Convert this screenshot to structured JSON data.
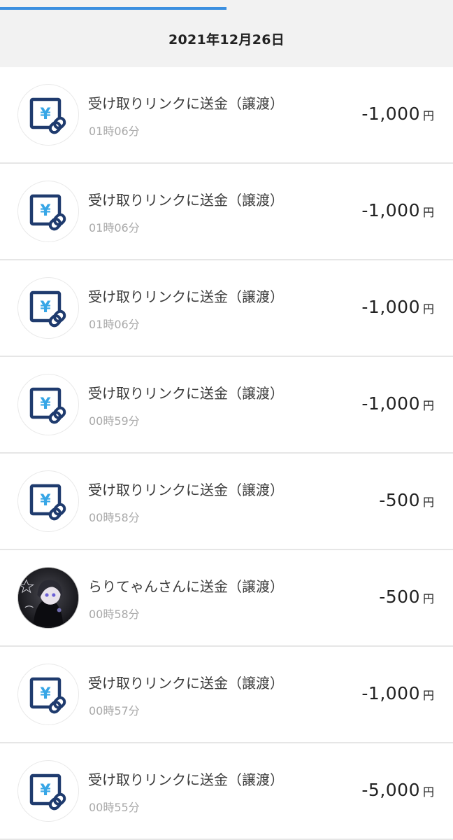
{
  "header": {
    "date": "2021年12月26日"
  },
  "colors": {
    "accent": "#3b8fe0",
    "icon_navy": "#1f3b6e",
    "icon_light_blue": "#37a6e6"
  },
  "transactions": [
    {
      "title": "受け取りリンクに送金（譲渡）",
      "time": "01時06分",
      "amount": "-1,000",
      "unit": "円",
      "icon": "yen-link-icon"
    },
    {
      "title": "受け取りリンクに送金（譲渡）",
      "time": "01時06分",
      "amount": "-1,000",
      "unit": "円",
      "icon": "yen-link-icon"
    },
    {
      "title": "受け取りリンクに送金（譲渡）",
      "time": "01時06分",
      "amount": "-1,000",
      "unit": "円",
      "icon": "yen-link-icon"
    },
    {
      "title": "受け取りリンクに送金（譲渡）",
      "time": "00時59分",
      "amount": "-1,000",
      "unit": "円",
      "icon": "yen-link-icon"
    },
    {
      "title": "受け取りリンクに送金（譲渡）",
      "time": "00時58分",
      "amount": "-500",
      "unit": "円",
      "icon": "yen-link-icon"
    },
    {
      "title": "らりてゃんさんに送金（譲渡）",
      "time": "00時58分",
      "amount": "-500",
      "unit": "円",
      "icon": "user-avatar"
    },
    {
      "title": "受け取りリンクに送金（譲渡）",
      "time": "00時57分",
      "amount": "-1,000",
      "unit": "円",
      "icon": "yen-link-icon"
    },
    {
      "title": "受け取りリンクに送金（譲渡）",
      "time": "00時55分",
      "amount": "-5,000",
      "unit": "円",
      "icon": "yen-link-icon"
    }
  ]
}
